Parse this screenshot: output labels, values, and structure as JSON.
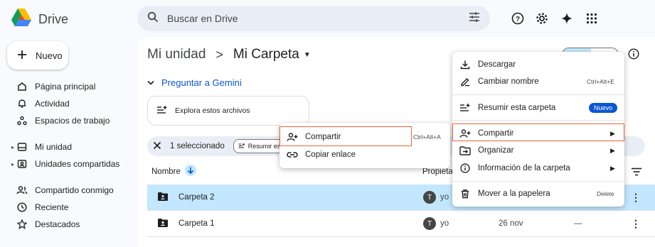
{
  "app": {
    "name": "Drive"
  },
  "search": {
    "placeholder": "Buscar en Drive"
  },
  "top_icons": [
    "help-icon",
    "settings-icon",
    "gemini-spark-icon",
    "apps-grid-icon"
  ],
  "new_button": {
    "label": "Nuevo"
  },
  "sidebar": {
    "items": [
      {
        "label": "Página principal",
        "icon": "home-icon"
      },
      {
        "label": "Actividad",
        "icon": "bell-icon"
      },
      {
        "label": "Espacios de trabajo",
        "icon": "workspaces-icon"
      },
      {
        "label": "Mi unidad",
        "icon": "my-drive-icon"
      },
      {
        "label": "Unidades compartidas",
        "icon": "shared-drives-icon"
      },
      {
        "label": "Compartido conmigo",
        "icon": "shared-with-me-icon"
      },
      {
        "label": "Reciente",
        "icon": "clock-icon"
      },
      {
        "label": "Destacados",
        "icon": "star-icon"
      }
    ]
  },
  "breadcrumb": {
    "root": "Mi unidad",
    "separator": ">",
    "current": "Mi Carpeta"
  },
  "gemini": {
    "label": "Preguntar a Gemini",
    "suggestion": "Explora estos archivos"
  },
  "selection_bar": {
    "count": "1 seleccionado",
    "chip": "Resumir es"
  },
  "columns": {
    "name": "Nombre",
    "owner": "Propieta"
  },
  "rows": [
    {
      "name": "Carpeta 2",
      "avatar": "T",
      "owner": "yo",
      "date": "",
      "selected": true
    },
    {
      "name": "Carpeta 1",
      "avatar": "T",
      "owner": "yo",
      "date": "26 nov",
      "dash": "—",
      "selected": false
    }
  ],
  "submenu": {
    "items": [
      {
        "label": "Compartir",
        "shortcut": "Ctrl+Alt+A",
        "icon": "person-add-icon"
      },
      {
        "label": "Copiar enlace",
        "icon": "link-icon"
      }
    ]
  },
  "context_menu": {
    "items": [
      {
        "label": "Descargar",
        "icon": "download-icon"
      },
      {
        "label": "Cambiar nombre",
        "shortcut": "Ctrl+Alt+E",
        "icon": "rename-icon"
      },
      {
        "label": "Resumir esta carpeta",
        "badge": "Nuevo",
        "icon": "summarize-icon"
      },
      {
        "label": "Compartir",
        "icon": "person-add-icon"
      },
      {
        "label": "Organizar",
        "icon": "folder-move-icon"
      },
      {
        "label": "Información de la carpeta",
        "icon": "info-icon"
      },
      {
        "label": "Mover a la papelera",
        "shortcut": "Delete",
        "icon": "trash-icon"
      }
    ]
  },
  "colors": {
    "accent": "#0b57d0",
    "selected_row": "#c2e7ff",
    "highlight_box": "#e8663d"
  }
}
